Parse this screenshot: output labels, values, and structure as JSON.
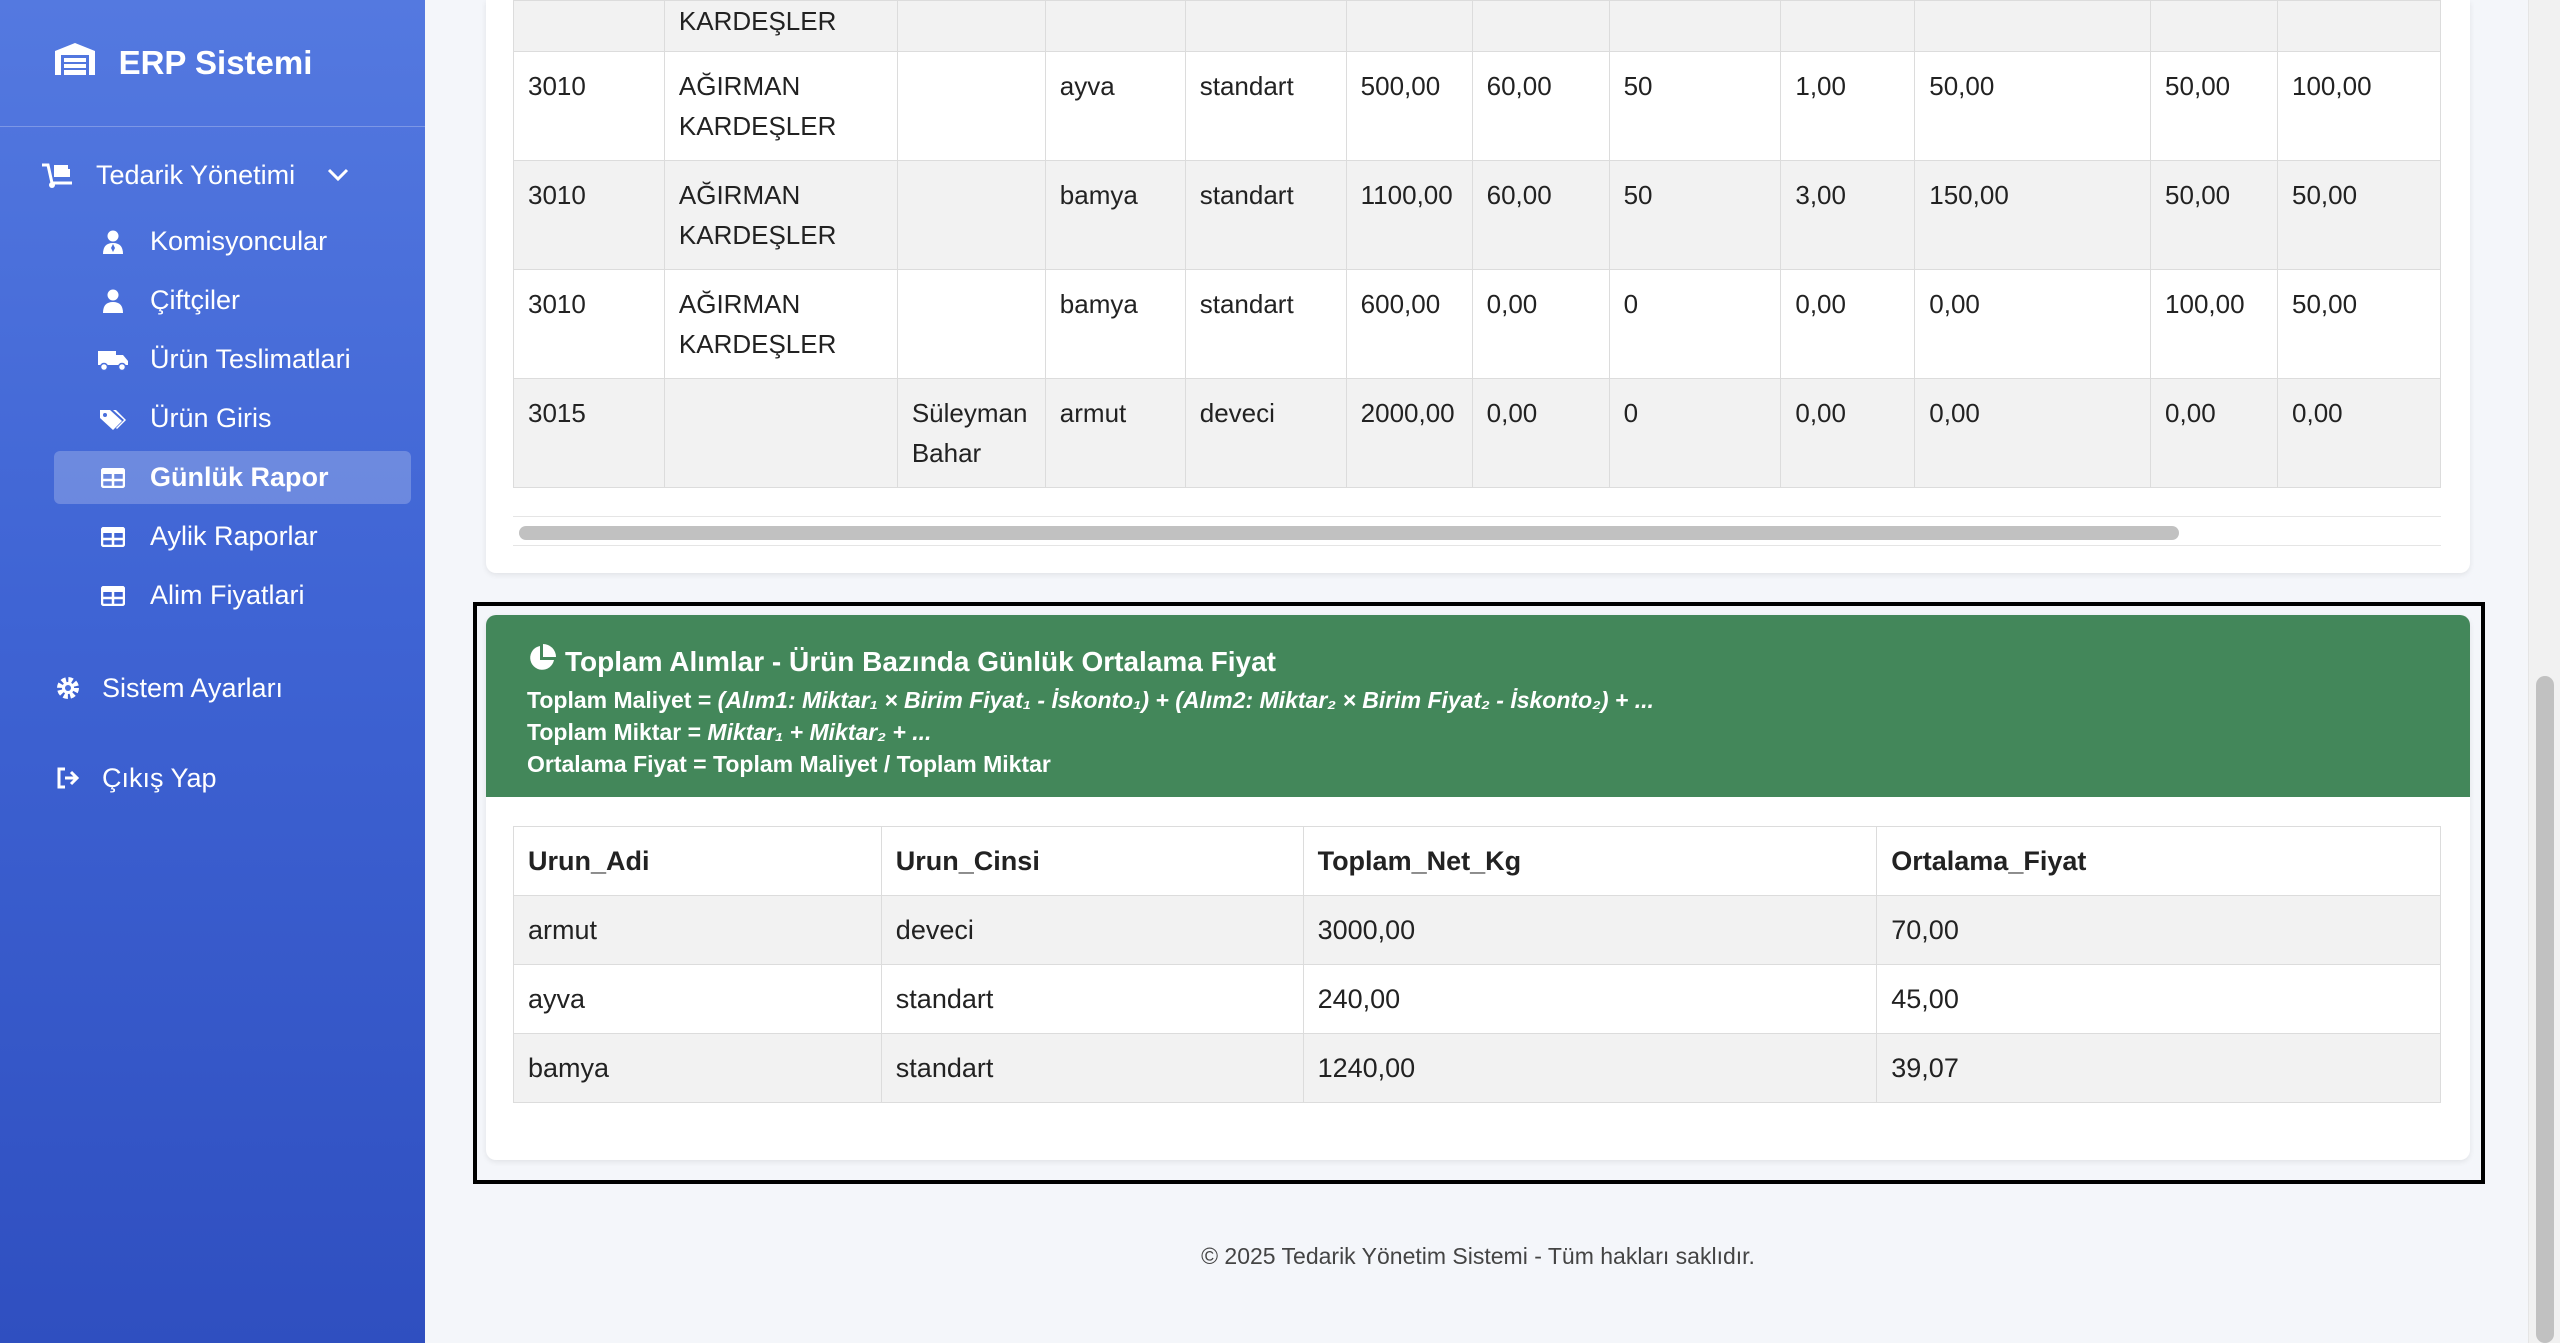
{
  "app": {
    "title": "ERP Sistemi"
  },
  "sidebar": {
    "group": {
      "label": "Tedarik Yönetimi"
    },
    "items": [
      {
        "label": "Komisyoncular",
        "icon": "user-tie-icon"
      },
      {
        "label": "Çiftçiler",
        "icon": "user-icon"
      },
      {
        "label": "Ürün Teslimatlari",
        "icon": "truck-icon"
      },
      {
        "label": "Ürün Giris",
        "icon": "tags-icon"
      },
      {
        "label": "Günlük Rapor",
        "icon": "table-icon",
        "active": true
      },
      {
        "label": "Aylik Raporlar",
        "icon": "table-icon"
      },
      {
        "label": "Alim Fiyatlari",
        "icon": "table-icon"
      }
    ],
    "settings": "Sistem Ayarları",
    "logout": "Çıkış Yap"
  },
  "detail_table": {
    "rows": [
      [
        "",
        "KARDEŞLER",
        "",
        "",
        "",
        "",
        "",
        "",
        "",
        "",
        "",
        ""
      ],
      [
        "3010",
        "AĞIRMAN KARDEŞLER",
        "",
        "ayva",
        "standart",
        "500,00",
        "60,00",
        "50",
        "1,00",
        "50,00",
        "50,00",
        "100,00"
      ],
      [
        "3010",
        "AĞIRMAN KARDEŞLER",
        "",
        "bamya",
        "standart",
        "1100,00",
        "60,00",
        "50",
        "3,00",
        "150,00",
        "50,00",
        "50,00"
      ],
      [
        "3010",
        "AĞIRMAN KARDEŞLER",
        "",
        "bamya",
        "standart",
        "600,00",
        "0,00",
        "0",
        "0,00",
        "0,00",
        "100,00",
        "50,00"
      ],
      [
        "3015",
        "",
        "Süleyman Bahar",
        "armut",
        "deveci",
        "2000,00",
        "0,00",
        "0",
        "0,00",
        "0,00",
        "0,00",
        "0,00"
      ]
    ]
  },
  "summary": {
    "title": "Toplam Alımlar - Ürün Bazında Günlük Ortalama Fiyat",
    "line1_label": "Toplam Maliyet =",
    "line1_formula": "(Alım1: Miktar₁ × Birim Fiyat₁ - İskonto₁) + (Alım2: Miktar₂ × Birim Fiyat₂ - İskonto₂) + ...",
    "line2_label": "Toplam Miktar =",
    "line2_formula": "Miktar₁ + Miktar₂ + ...",
    "line3": "Ortalama Fiyat = Toplam Maliyet / Toplam Miktar",
    "header_color": "#43875a",
    "columns": [
      "Urun_Adi",
      "Urun_Cinsi",
      "Toplam_Net_Kg",
      "Ortalama_Fiyat"
    ],
    "rows": [
      [
        "armut",
        "deveci",
        "3000,00",
        "70,00"
      ],
      [
        "ayva",
        "standart",
        "240,00",
        "45,00"
      ],
      [
        "bamya",
        "standart",
        "1240,00",
        "39,07"
      ]
    ]
  },
  "footer": "© 2025 Tedarik Yönetim Sistemi - Tüm hakları saklıdır."
}
